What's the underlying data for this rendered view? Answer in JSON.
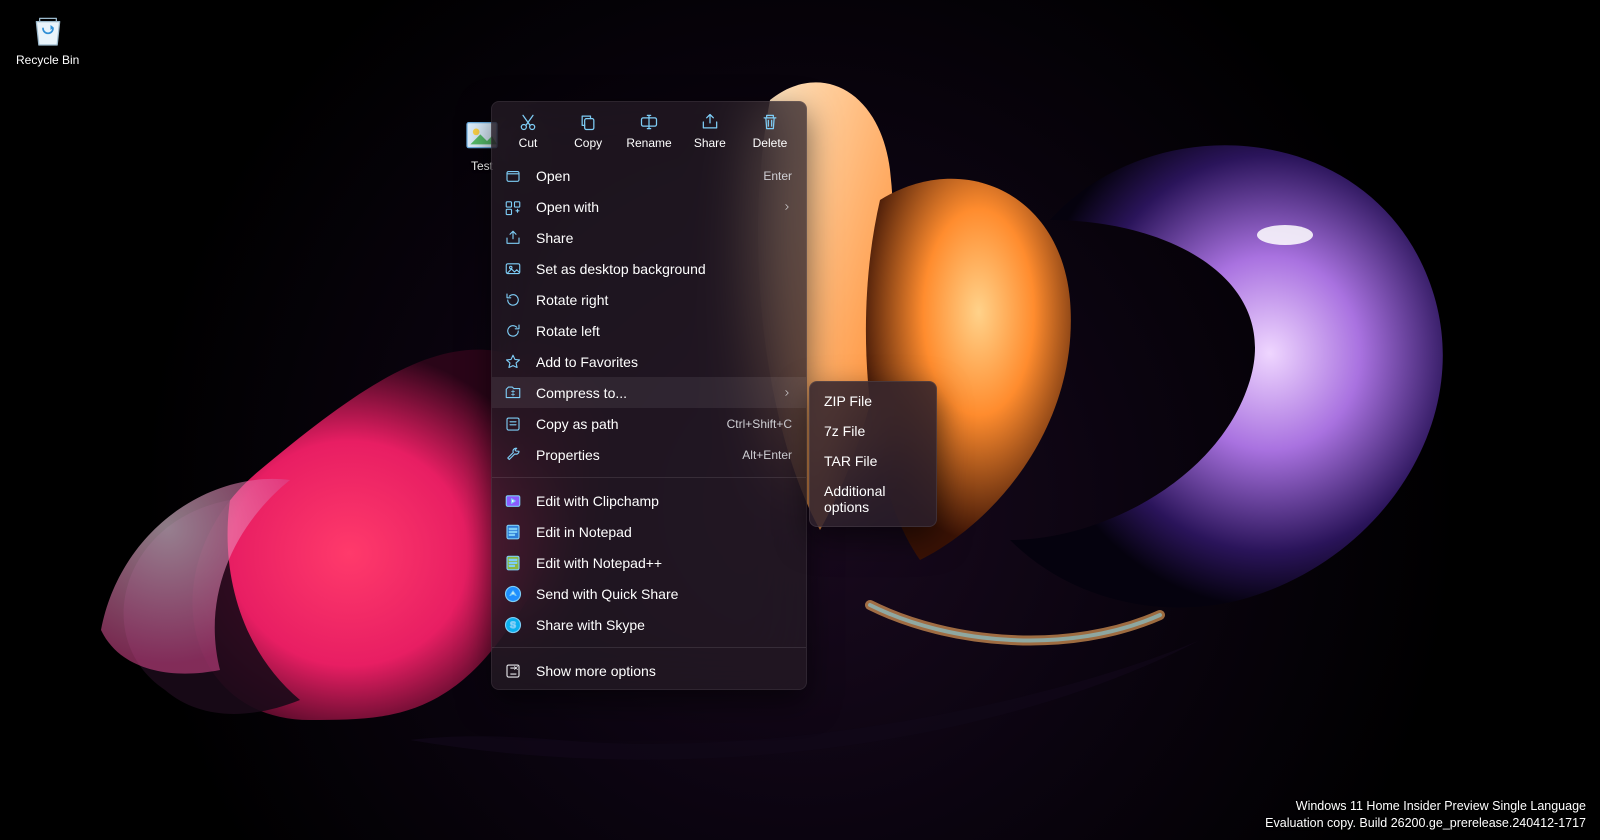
{
  "desktop_icons": {
    "recycle": "Recycle Bin",
    "testfile": "Test"
  },
  "watermark": {
    "line1": "Windows 11 Home Insider Preview Single Language",
    "line2": "Evaluation copy. Build 26200.ge_prerelease.240412-1717"
  },
  "context_menu": {
    "top": {
      "cut": "Cut",
      "copy": "Copy",
      "rename": "Rename",
      "share": "Share",
      "delete": "Delete"
    },
    "items": [
      {
        "icon": "open",
        "label": "Open",
        "accel": "Enter"
      },
      {
        "icon": "openwith",
        "label": "Open with",
        "chev": true
      },
      {
        "icon": "share",
        "label": "Share"
      },
      {
        "icon": "setbg",
        "label": "Set as desktop background"
      },
      {
        "icon": "rotr",
        "label": "Rotate right"
      },
      {
        "icon": "rotl",
        "label": "Rotate left"
      },
      {
        "icon": "fav",
        "label": "Add to Favorites"
      },
      {
        "icon": "compress",
        "label": "Compress to...",
        "chev": true,
        "hovered": true
      },
      {
        "icon": "copypath",
        "label": "Copy as path",
        "accel": "Ctrl+Shift+C"
      },
      {
        "icon": "props",
        "label": "Properties",
        "accel": "Alt+Enter"
      }
    ],
    "apps": [
      {
        "icon": "clip",
        "label": "Edit with Clipchamp"
      },
      {
        "icon": "np",
        "label": "Edit in Notepad"
      },
      {
        "icon": "npp",
        "label": "Edit with Notepad++"
      },
      {
        "icon": "qshare",
        "label": "Send with Quick Share"
      },
      {
        "icon": "skype",
        "label": "Share with Skype"
      }
    ],
    "more": "Show more options"
  },
  "submenu": {
    "items": [
      "ZIP File",
      "7z File",
      "TAR File",
      "Additional options"
    ]
  }
}
